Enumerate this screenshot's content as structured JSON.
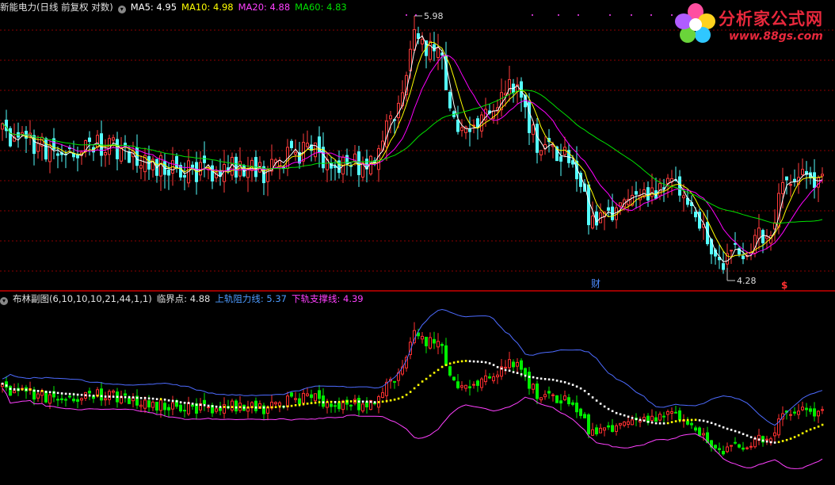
{
  "main_header": {
    "title": "新能电力(日线 前复权 对数)",
    "ma5_label": "MA5: 4.95",
    "ma10_label": "MA10: 4.98",
    "ma20_label": "MA20: 4.88",
    "ma60_label": "MA60: 4.83"
  },
  "sub_header": {
    "title": "布林副图(6,10,10,10,21,44,1,1)",
    "critical_label": "临界点: 4.88",
    "upper_label": "上轨阻力线: 5.37",
    "lower_label": "下轨支撑线: 4.39"
  },
  "logo": {
    "title": "分析家公式网",
    "url": "www.88gs.com"
  },
  "annotations": {
    "high_label": "5.98",
    "low_label": "4.28",
    "cai_label": "财",
    "s_label": "$"
  },
  "colors": {
    "up": "#ff3c3c",
    "down": "#54ffff",
    "ma5": "#ffffff",
    "ma10": "#ffff00",
    "ma20": "#ff00ff",
    "ma60": "#00e000",
    "upper": "#4d6bff",
    "lower": "#ff40ff",
    "mid_up": "#ffff00",
    "mid_down": "#ffffff",
    "grid": "#8b0000",
    "sub_up": "#ff3030",
    "sub_down": "#00ee00"
  },
  "chart_data": [
    {
      "type": "candlestick",
      "title": "新能电力(日线 前复权 对数)",
      "series": [
        {
          "name": "MA5",
          "last": 4.95
        },
        {
          "name": "MA10",
          "last": 4.98
        },
        {
          "name": "MA20",
          "last": 4.88
        },
        {
          "name": "MA60",
          "last": 4.83
        }
      ],
      "annotations": [
        {
          "text": "5.98",
          "kind": "high"
        },
        {
          "text": "4.28",
          "kind": "low"
        }
      ],
      "price_range": [
        4.28,
        5.98
      ],
      "trend": [
        [
          0,
          5.12
        ],
        [
          40,
          5.05
        ],
        [
          80,
          4.98
        ],
        [
          110,
          5.04
        ],
        [
          150,
          5.02
        ],
        [
          190,
          4.92
        ],
        [
          230,
          4.88
        ],
        [
          260,
          4.86
        ],
        [
          300,
          4.9
        ],
        [
          330,
          4.85
        ],
        [
          360,
          4.95
        ],
        [
          390,
          5.02
        ],
        [
          410,
          4.93
        ],
        [
          440,
          4.9
        ],
        [
          460,
          4.92
        ],
        [
          480,
          5.02
        ],
        [
          500,
          5.28
        ],
        [
          515,
          5.62
        ],
        [
          525,
          5.9
        ],
        [
          540,
          5.72
        ],
        [
          555,
          5.75
        ],
        [
          565,
          5.4
        ],
        [
          580,
          5.12
        ],
        [
          600,
          5.15
        ],
        [
          615,
          5.28
        ],
        [
          630,
          5.38
        ],
        [
          650,
          5.45
        ],
        [
          665,
          5.2
        ],
        [
          680,
          5.02
        ],
        [
          700,
          4.98
        ],
        [
          720,
          4.95
        ],
        [
          735,
          4.72
        ],
        [
          745,
          4.55
        ],
        [
          760,
          4.62
        ],
        [
          780,
          4.63
        ],
        [
          800,
          4.66
        ],
        [
          820,
          4.75
        ],
        [
          840,
          4.78
        ],
        [
          860,
          4.76
        ],
        [
          880,
          4.62
        ],
        [
          895,
          4.4
        ],
        [
          905,
          4.32
        ],
        [
          915,
          4.3
        ],
        [
          935,
          4.38
        ],
        [
          955,
          4.45
        ],
        [
          975,
          4.52
        ],
        [
          990,
          4.78
        ],
        [
          1005,
          4.84
        ],
        [
          1020,
          4.86
        ],
        [
          1030,
          4.8
        ],
        [
          1040,
          4.82
        ]
      ]
    },
    {
      "type": "line",
      "title": "布林副图(6,10,10,10,21,44,1,1)",
      "series": [
        {
          "name": "临界点",
          "last": 4.88
        },
        {
          "name": "上轨阻力线",
          "last": 5.37
        },
        {
          "name": "下轨支撑线",
          "last": 4.39
        }
      ]
    }
  ]
}
